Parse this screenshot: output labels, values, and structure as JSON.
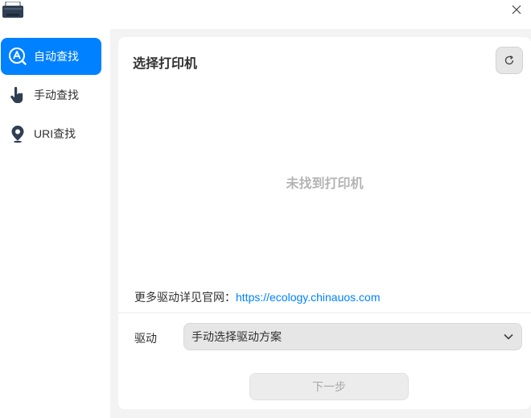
{
  "window": {
    "app_icon": "printer-icon",
    "close_icon": "close-icon"
  },
  "sidebar": {
    "items": [
      {
        "label": "自动查找",
        "icon": "auto-search-icon",
        "active": true
      },
      {
        "label": "手动查找",
        "icon": "hand-pointer-icon",
        "active": false
      },
      {
        "label": "URI查找",
        "icon": "location-pin-icon",
        "active": false
      }
    ]
  },
  "main": {
    "title": "选择打印机",
    "refresh_icon": "refresh-icon",
    "empty_message": "未找到打印机",
    "more_drivers_text": "更多驱动详见官网：",
    "more_drivers_link": "https://ecology.chinauos.com",
    "driver_label": "驱动",
    "driver_select_value": "手动选择驱动方案",
    "next_button": "下一步"
  },
  "colors": {
    "accent": "#0081ff",
    "disabled_text": "#a8a8a8",
    "empty_text": "#b4b4b4"
  }
}
